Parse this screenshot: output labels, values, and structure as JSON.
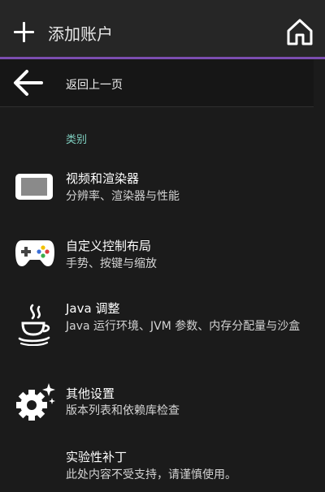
{
  "topbar": {
    "title": "添加账户",
    "add_icon": "plus-icon",
    "home_icon": "home-icon"
  },
  "back": {
    "label": "返回上一页",
    "icon": "arrow-left-icon"
  },
  "section": "类别",
  "items": [
    {
      "title": "视频和渲染器",
      "subtitle": "分辨率、渲染器与性能",
      "icon": "display-icon"
    },
    {
      "title": "自定义控制布局",
      "subtitle": "手势、按键与缩放",
      "icon": "gamepad-icon"
    },
    {
      "title": "Java 调整",
      "subtitle": "Java 运行环境、JVM 参数、内存分配量与沙盒",
      "icon": "java-cup-icon"
    },
    {
      "title": "其他设置",
      "subtitle": "版本列表和依赖库检查",
      "icon": "gear-sparkle-icon"
    },
    {
      "title": "实验性补丁",
      "subtitle": "此处内容不受支持，请谨慎使用。",
      "icon": ""
    }
  ],
  "colors": {
    "accent": "#7b4db0",
    "section_label": "#7fcfc0",
    "background": "#1b1b1b"
  }
}
